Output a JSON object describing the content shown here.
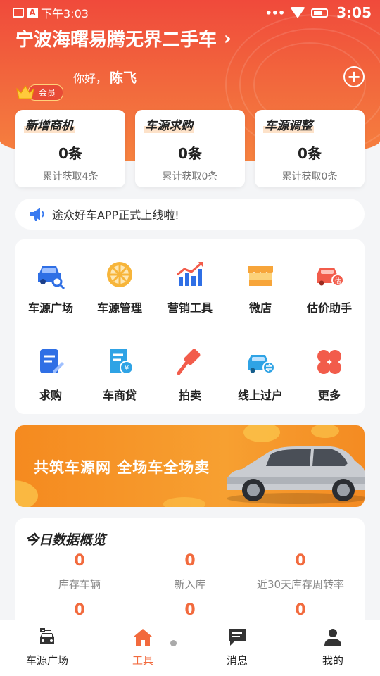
{
  "status_bar": {
    "left_text": "下午3:03",
    "time": "3:05",
    "battery_label": "92"
  },
  "header": {
    "store_name": "宁波海曙易腾无界二手车",
    "greeting": "你好，",
    "user_name": "陈飞",
    "member_label": "会员"
  },
  "stats": [
    {
      "title": "新增商机",
      "value": "0条",
      "sub": "累计获取4条"
    },
    {
      "title": "车源求购",
      "value": "0条",
      "sub": "累计获取0条"
    },
    {
      "title": "车源调整",
      "value": "0条",
      "sub": "累计获取0条"
    }
  ],
  "notice": {
    "text": "途众好车APP正式上线啦!"
  },
  "tools": [
    {
      "label": "车源广场",
      "icon": "car-search-icon"
    },
    {
      "label": "车源管理",
      "icon": "wheel-icon"
    },
    {
      "label": "营销工具",
      "icon": "chart-growth-icon"
    },
    {
      "label": "微店",
      "icon": "shop-icon"
    },
    {
      "label": "估价助手",
      "icon": "car-valuation-icon"
    },
    {
      "label": "求购",
      "icon": "document-edit-icon"
    },
    {
      "label": "车商贷",
      "icon": "loan-receipt-icon"
    },
    {
      "label": "拍卖",
      "icon": "auction-hammer-icon"
    },
    {
      "label": "线上过户",
      "icon": "car-transfer-icon"
    },
    {
      "label": "更多",
      "icon": "more-grid-icon"
    }
  ],
  "banner": {
    "text": "共筑车源网  全场车全场卖"
  },
  "overview": {
    "title": "今日数据概览",
    "metrics": [
      {
        "value": "0",
        "label": "库存车辆"
      },
      {
        "value": "0",
        "label": "新入库"
      },
      {
        "value": "0",
        "label": "近30天库存周转率"
      },
      {
        "value": "0",
        "label": ""
      },
      {
        "value": "0",
        "label": ""
      },
      {
        "value": "0",
        "label": ""
      }
    ]
  },
  "nav": [
    {
      "label": "车源广场",
      "icon": "car-square-icon",
      "active": false
    },
    {
      "label": "工具",
      "icon": "home-icon",
      "active": true
    },
    {
      "label": "消息",
      "icon": "message-icon",
      "active": false
    },
    {
      "label": "我的",
      "icon": "user-icon",
      "active": false
    }
  ],
  "colors": {
    "accent": "#f26a3d",
    "header_red": "#f04a3b",
    "banner_orange": "#f7a031"
  }
}
